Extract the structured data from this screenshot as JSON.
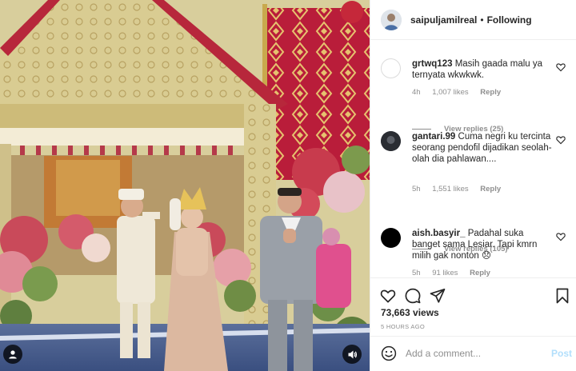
{
  "post": {
    "username": "saipuljamilreal",
    "separator": "•",
    "follow_status": "Following"
  },
  "comments": [
    {
      "username": "grtwq123",
      "text": "Masih gaada malu ya ternyata wkwkwk.",
      "time": "4h",
      "likes": "1,007 likes",
      "reply_label": "Reply",
      "view_replies": "View replies (25)",
      "avatar_color": "#ffffff"
    },
    {
      "username": "gantari.99",
      "text": "Cuma negri ku tercinta seorang pendofil dijadikan seolah-olah dia pahlawan....",
      "time": "5h",
      "likes": "1,551 likes",
      "reply_label": "Reply",
      "view_replies": "View replies (105)",
      "avatar_color": "#2a2d33"
    },
    {
      "username": "aish.basyir_",
      "text": "Padahal suka banget sama Lesiar. Tapi kmrn milih gak nonton",
      "emoji": "😞",
      "time": "5h",
      "likes": "91 likes",
      "reply_label": "Reply",
      "avatar_color": "#000000"
    }
  ],
  "stats": {
    "views": "73,663 views",
    "posted": "5 HOURS AGO"
  },
  "add_comment": {
    "placeholder": "Add a comment...",
    "post_label": "Post"
  },
  "icons": {
    "like": "heart-icon",
    "comment": "comment-icon",
    "share": "paper-plane-icon",
    "save": "bookmark-icon",
    "emoji": "smiley-icon",
    "video_user": "user-icon",
    "video_sound": "speaker-icon"
  },
  "colors": {
    "text": "#262626",
    "muted": "#8e8e8e",
    "border": "#efefef",
    "post_disabled": "#b2dffc"
  }
}
